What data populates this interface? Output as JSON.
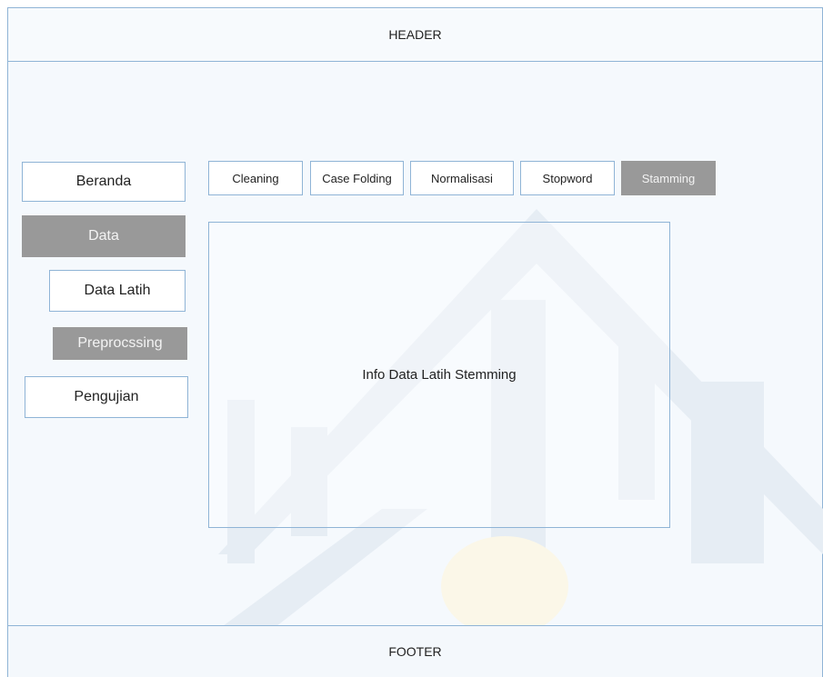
{
  "header": {
    "title": "HEADER"
  },
  "footer": {
    "title": "FOOTER"
  },
  "sidebar": {
    "items": [
      {
        "label": "Beranda",
        "active": false
      },
      {
        "label": "Data",
        "active": true
      },
      {
        "label": "Data Latih",
        "active": false
      },
      {
        "label": "Preprocssing",
        "active": true
      },
      {
        "label": "Pengujian",
        "active": false
      }
    ]
  },
  "tabs": [
    {
      "label": "Cleaning",
      "active": false
    },
    {
      "label": "Case Folding",
      "active": false
    },
    {
      "label": "Normalisasi",
      "active": false
    },
    {
      "label": "Stopword",
      "active": false
    },
    {
      "label": "Stamming",
      "active": true
    }
  ],
  "content": {
    "label": "Info Data Latih Stemming"
  },
  "colors": {
    "border": "#8fb4d6",
    "active_fill": "#999999",
    "active_text": "#f3f3f3",
    "background": "#f5f9fd"
  }
}
